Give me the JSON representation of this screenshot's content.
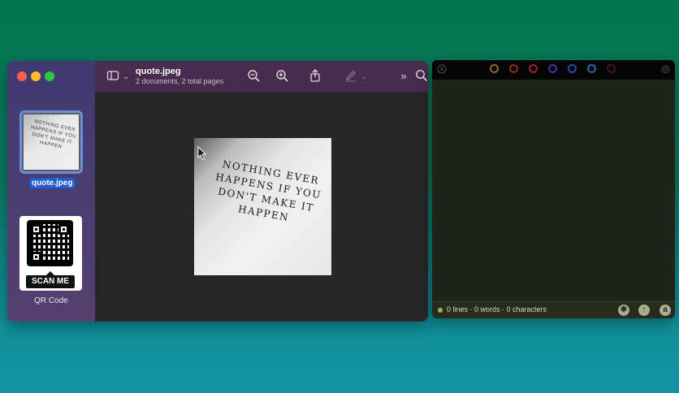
{
  "preview": {
    "title": "quote.jpeg",
    "subtitle": "2 documents, 2 total pages",
    "sidebar": {
      "items": [
        {
          "label": "quote.jpeg",
          "selected": true
        },
        {
          "label": "QR Code",
          "selected": false,
          "badge_text": "SCAN ME"
        }
      ]
    },
    "image_text": "NOTHING EVER HAPPENS IF YOU DON'T MAKE IT HAPPEN",
    "icons": [
      "sidebar-toggle-icon",
      "chevron-down-icon",
      "zoom-out-icon",
      "zoom-in-icon",
      "share-icon",
      "markup-pen-icon",
      "chevron-down-icon",
      "more-chevron-icon",
      "search-icon"
    ]
  },
  "editor": {
    "status": "0 lines · 0 words · 0 characters",
    "color_rings": [
      "#8a6a2a",
      "#8a2a2a",
      "#9a1f2f",
      "#3a3a9a",
      "#2a4aa0",
      "#2a6aa0",
      "#3a1a1a"
    ],
    "status_dot_color": "#8bc34a",
    "buttons": [
      "asterisk-icon",
      "upload-arrow-icon",
      "font-a-icon"
    ]
  }
}
